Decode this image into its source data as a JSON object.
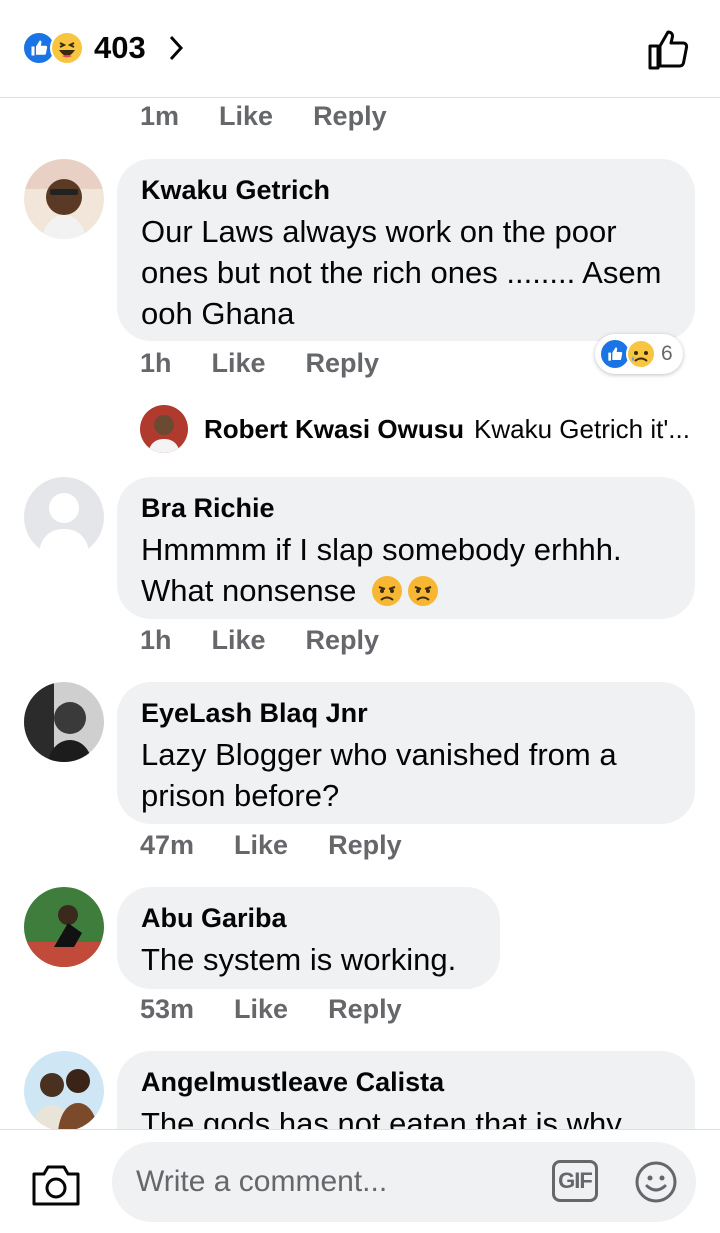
{
  "header": {
    "reaction_count": "403",
    "reactions": [
      "like-icon",
      "haha-icon"
    ]
  },
  "top_meta": {
    "time": "1m",
    "like": "Like",
    "reply": "Reply"
  },
  "comments": [
    {
      "author": "Kwaku Getrich",
      "text": "Our Laws always work on the poor ones but not the rich ones  ........ Asem  ooh Ghana",
      "time": "1h",
      "like": "Like",
      "reply": "Reply",
      "reaction_count": "6",
      "reactions": [
        "like-icon",
        "sad-icon"
      ]
    },
    {
      "author": "Bra Richie",
      "text": "Hmmmm if I slap somebody erhhh. What nonsense",
      "emojis": [
        "frown-icon",
        "frown-icon"
      ],
      "time": "1h",
      "like": "Like",
      "reply": "Reply"
    },
    {
      "author": "EyeLash Blaq Jnr",
      "text": "Lazy Blogger who vanished from a prison before?",
      "time": "47m",
      "like": "Like",
      "reply": "Reply"
    },
    {
      "author": "Abu Gariba",
      "text": "The system is working.",
      "time": "53m",
      "like": "Like",
      "reply": "Reply"
    },
    {
      "author": "Angelmustleave Calista",
      "text": "The gods has not eaten that is why"
    }
  ],
  "reply_preview": {
    "author": "Robert Kwasi Owusu",
    "text": "Kwaku Getrich it'..."
  },
  "composer": {
    "placeholder": "Write a comment...",
    "gif_label": "GIF"
  },
  "colors": {
    "accent": "#1b74e4",
    "bubble": "#eff1f3",
    "muted": "#65676b"
  }
}
